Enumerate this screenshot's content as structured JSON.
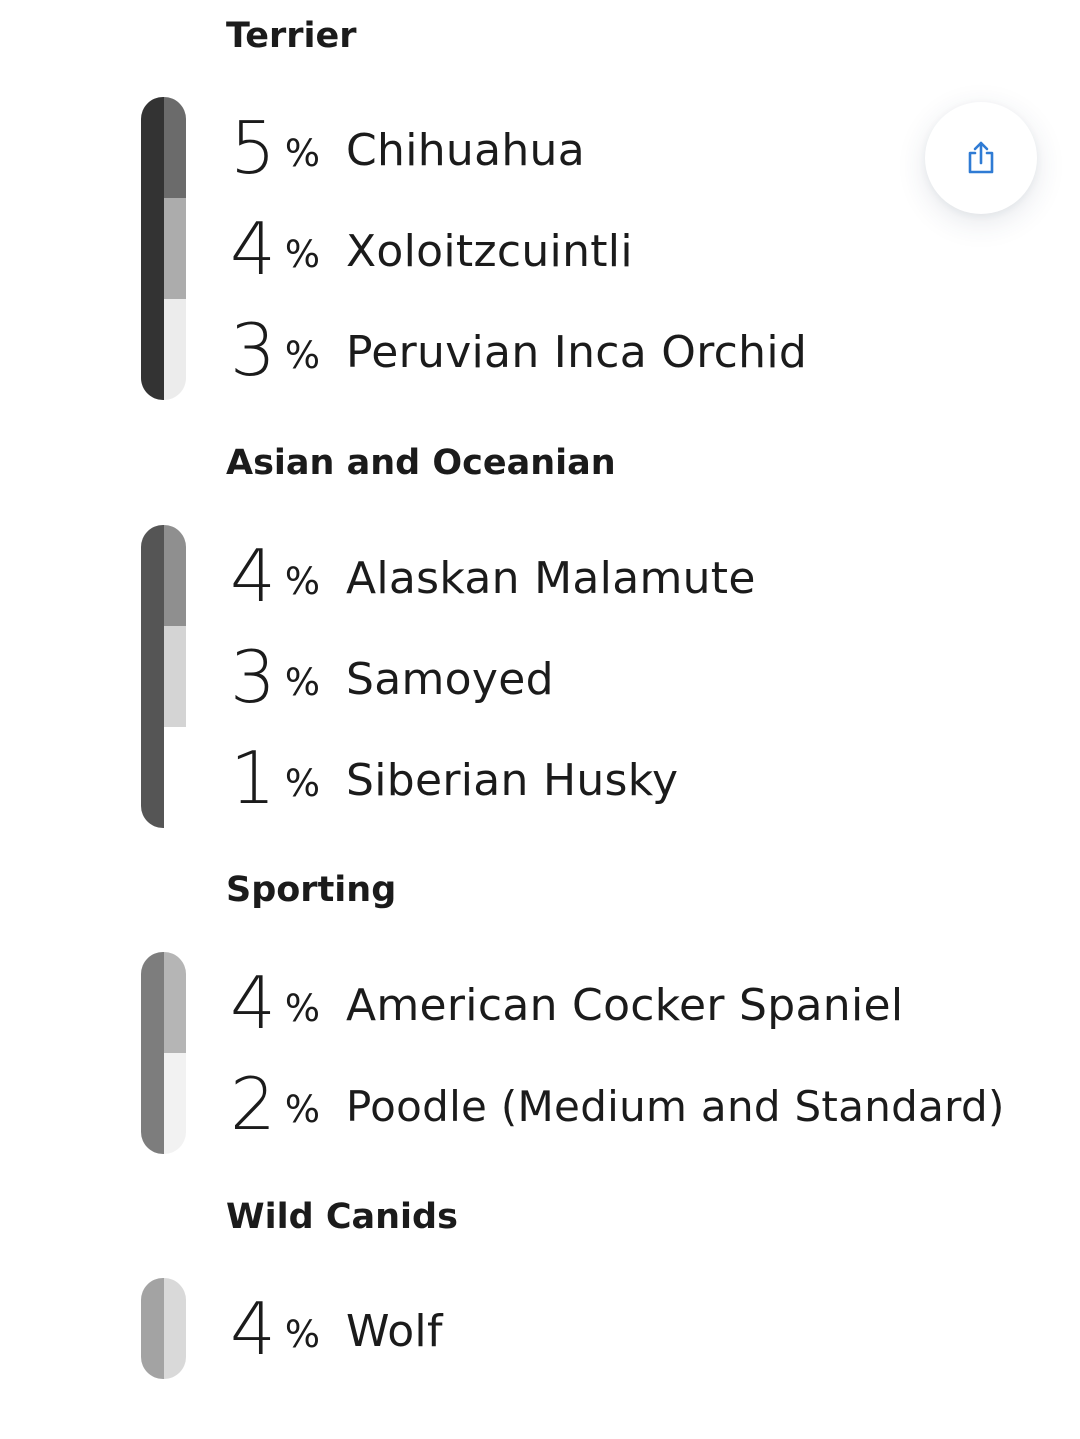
{
  "groups": [
    {
      "title": "Terrier",
      "bar_base_color": "#333333",
      "breeds": [
        {
          "value": "5",
          "sign": "%",
          "name": "Chihuahua",
          "color": "#6b6b6b"
        },
        {
          "value": "4",
          "sign": "%",
          "name": "Xoloitzcuintli",
          "color": "#acacac"
        },
        {
          "value": "3",
          "sign": "%",
          "name": "Peruvian Inca Orchid",
          "color": "#ececec"
        }
      ]
    },
    {
      "title": "Asian and Oceanian",
      "bar_base_color": "#555555",
      "breeds": [
        {
          "value": "4",
          "sign": "%",
          "name": "Alaskan Malamute",
          "color": "#8f8f8f"
        },
        {
          "value": "3",
          "sign": "%",
          "name": "Samoyed",
          "color": "#d4d4d4"
        },
        {
          "value": "1",
          "sign": "%",
          "name": "Siberian Husky",
          "color": "#ffffff"
        }
      ]
    },
    {
      "title": "Sporting",
      "bar_base_color": "#7d7d7d",
      "breeds": [
        {
          "value": "4",
          "sign": "%",
          "name": "American Cocker Spaniel",
          "color": "#b5b5b5"
        },
        {
          "value": "2",
          "sign": "%",
          "name": "Poodle (Medium and Standard)",
          "color": "#f2f2f2"
        }
      ]
    },
    {
      "title": "Wild Canids",
      "bar_base_color": "#a3a3a3",
      "breeds": [
        {
          "value": "4",
          "sign": "%",
          "name": "Wolf",
          "color": "#d9d9d9"
        }
      ]
    }
  ],
  "share_button": {
    "icon": "share-icon",
    "color": "#2f7bd4"
  }
}
